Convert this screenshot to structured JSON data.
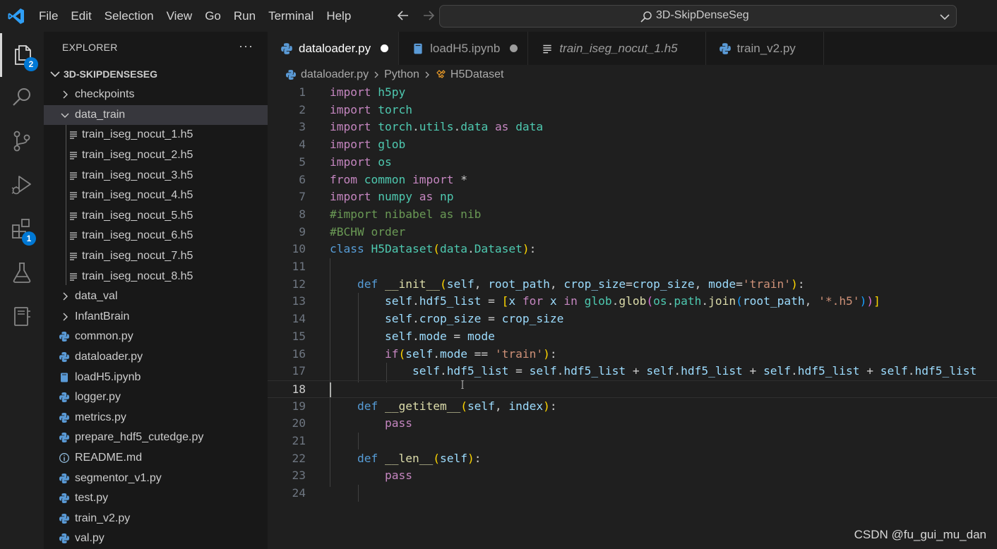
{
  "menu": [
    "File",
    "Edit",
    "Selection",
    "View",
    "Go",
    "Run",
    "Terminal",
    "Help"
  ],
  "command_center": {
    "text": "3D-SkipDenseSeg"
  },
  "activity": {
    "explorer_badge": "2",
    "extensions_badge": "1"
  },
  "sidebar": {
    "title": "EXPLORER",
    "more": "···",
    "root": "3D-SKIPDENSESEG",
    "items": [
      {
        "label": "checkpoints",
        "type": "folder-closed"
      },
      {
        "label": "data_train",
        "type": "folder-open"
      },
      {
        "label": "train_iseg_nocut_1.h5",
        "type": "file-lines"
      },
      {
        "label": "train_iseg_nocut_2.h5",
        "type": "file-lines"
      },
      {
        "label": "train_iseg_nocut_3.h5",
        "type": "file-lines"
      },
      {
        "label": "train_iseg_nocut_4.h5",
        "type": "file-lines"
      },
      {
        "label": "train_iseg_nocut_5.h5",
        "type": "file-lines"
      },
      {
        "label": "train_iseg_nocut_6.h5",
        "type": "file-lines"
      },
      {
        "label": "train_iseg_nocut_7.h5",
        "type": "file-lines"
      },
      {
        "label": "train_iseg_nocut_8.h5",
        "type": "file-lines"
      },
      {
        "label": "data_val",
        "type": "folder-closed"
      },
      {
        "label": "InfantBrain",
        "type": "folder-closed"
      },
      {
        "label": "common.py",
        "type": "python"
      },
      {
        "label": "dataloader.py",
        "type": "python"
      },
      {
        "label": "loadH5.ipynb",
        "type": "notebook"
      },
      {
        "label": "logger.py",
        "type": "python"
      },
      {
        "label": "metrics.py",
        "type": "python"
      },
      {
        "label": "prepare_hdf5_cutedge.py",
        "type": "python"
      },
      {
        "label": "README.md",
        "type": "info"
      },
      {
        "label": "segmentor_v1.py",
        "type": "python"
      },
      {
        "label": "test.py",
        "type": "python"
      },
      {
        "label": "train_v2.py",
        "type": "python"
      },
      {
        "label": "val.py",
        "type": "python"
      }
    ]
  },
  "tabs": [
    {
      "label": "dataloader.py",
      "icon": "python-icon",
      "modified": true,
      "active": true
    },
    {
      "label": "loadH5.ipynb",
      "icon": "notebook-icon",
      "modified": true,
      "active": false
    },
    {
      "label": "train_iseg_nocut_1.h5",
      "icon": "file-lines-icon",
      "modified": false,
      "active": false,
      "preview": true
    },
    {
      "label": "train_v2.py",
      "icon": "python-icon",
      "modified": false,
      "active": false
    }
  ],
  "breadcrumb": {
    "file": "dataloader.py",
    "language": "Python",
    "symbol": "H5Dataset"
  },
  "editor": {
    "current_line": 18,
    "lines": [
      "import h5py",
      "import torch",
      "import torch.utils.data as data",
      "import glob",
      "import os",
      "from common import *",
      "import numpy as np",
      "#import nibabel as nib",
      "#BCHW order",
      "class H5Dataset(data.Dataset):",
      "",
      "    def __init__(self, root_path, crop_size=crop_size, mode='train'):",
      "        self.hdf5_list = [x for x in glob.glob(os.path.join(root_path, '*.h5'))]",
      "        self.crop_size = crop_size",
      "        self.mode = mode",
      "        if(self.mode == 'train'):",
      "            self.hdf5_list = self.hdf5_list + self.hdf5_list + self.hdf5_list + self.hdf5_list",
      "",
      "    def __getitem__(self, index):",
      "        pass",
      "",
      "    def __len__(self):",
      "        pass",
      ""
    ]
  },
  "watermark": "CSDN @fu_gui_mu_dan",
  "colors": {
    "accent": "#0078d4",
    "background": "#1f1f1f",
    "sidebar": "#181818"
  }
}
